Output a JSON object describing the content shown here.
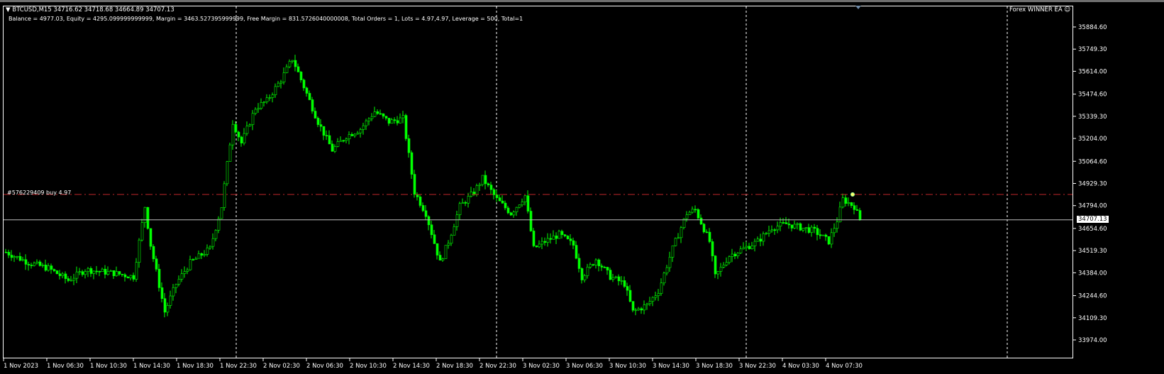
{
  "header": {
    "symbol_line": "▼ BTCUSD,M15  34716.62 34718.68 34664.89 34707.13",
    "account_line": "Balance = 4977.03, Equity = 4295.099999999999, Margin = 3463.527395999999, Free Margin = 831.5726040000008, Total Orders = 1, Lots = 4.97,4.97, Leverage = 500, Total=1"
  },
  "ea_label": "Forex WINNER EA ☺",
  "order_label": "#576229409 buy 4.97",
  "current_price_label": "34707.13",
  "colors": {
    "bull": "#00ff00",
    "bear": "#00ff00",
    "order_line": "#c0262a",
    "price_line": "#c0c0c0",
    "grid": "#ffffff"
  },
  "chart_data": {
    "type": "candlestick",
    "symbol": "BTCUSD",
    "timeframe": "M15",
    "ylim": [
      33974.0,
      35884.6
    ],
    "y_ticks": [
      "35884.60",
      "35749.30",
      "35614.00",
      "35474.60",
      "35339.30",
      "35204.00",
      "35064.60",
      "34929.30",
      "34794.00",
      "34654.60",
      "34519.30",
      "34384.00",
      "34244.60",
      "34109.30",
      "33974.00"
    ],
    "y_tick_values": [
      35884.6,
      35749.3,
      35614.0,
      35474.6,
      35339.3,
      35204.0,
      35064.6,
      34929.3,
      34794.0,
      34654.6,
      34519.3,
      34384.0,
      34244.6,
      34109.3,
      33974.0
    ],
    "x_ticks": [
      "1 Nov 2023",
      "1 Nov 06:30",
      "1 Nov 10:30",
      "1 Nov 14:30",
      "1 Nov 18:30",
      "1 Nov 22:30",
      "2 Nov 02:30",
      "2 Nov 06:30",
      "2 Nov 10:30",
      "2 Nov 14:30",
      "2 Nov 18:30",
      "2 Nov 22:30",
      "3 Nov 02:30",
      "3 Nov 06:30",
      "3 Nov 10:30",
      "3 Nov 14:30",
      "3 Nov 18:30",
      "3 Nov 22:30",
      "4 Nov 03:30",
      "4 Nov 07:30"
    ],
    "order_price": 34862,
    "current_price": 34707.13,
    "close_path": {
      "bar": [
        0,
        8,
        15,
        22,
        28,
        38,
        45,
        49,
        51,
        56,
        60,
        65,
        72,
        76,
        80,
        83,
        88,
        92,
        97,
        101,
        105,
        110,
        115,
        120,
        125,
        130,
        135,
        140,
        144,
        148,
        153,
        156,
        160,
        165,
        168,
        173,
        178,
        183,
        186,
        190,
        195,
        200,
        203,
        208,
        213,
        218,
        221,
        226,
        230,
        235,
        240,
        243,
        248,
        250,
        255,
        260,
        265,
        270,
        275,
        280,
        285,
        290,
        293,
        295,
        299,
        301
      ],
      "close": [
        34510,
        34446,
        34411,
        34338,
        34403,
        34382,
        34360,
        34789,
        34553,
        34145,
        34317,
        34446,
        34532,
        34789,
        35305,
        35176,
        35391,
        35434,
        35563,
        35691,
        35520,
        35305,
        35133,
        35219,
        35262,
        35369,
        35305,
        35326,
        34876,
        34747,
        34446,
        34575,
        34789,
        34876,
        34961,
        34832,
        34747,
        34854,
        34532,
        34575,
        34618,
        34553,
        34360,
        34467,
        34360,
        34317,
        34145,
        34188,
        34274,
        34532,
        34747,
        34768,
        34575,
        34360,
        34489,
        34532,
        34575,
        34661,
        34682,
        34661,
        34639,
        34575,
        34704,
        34832,
        34789,
        34707.13
      ]
    }
  }
}
